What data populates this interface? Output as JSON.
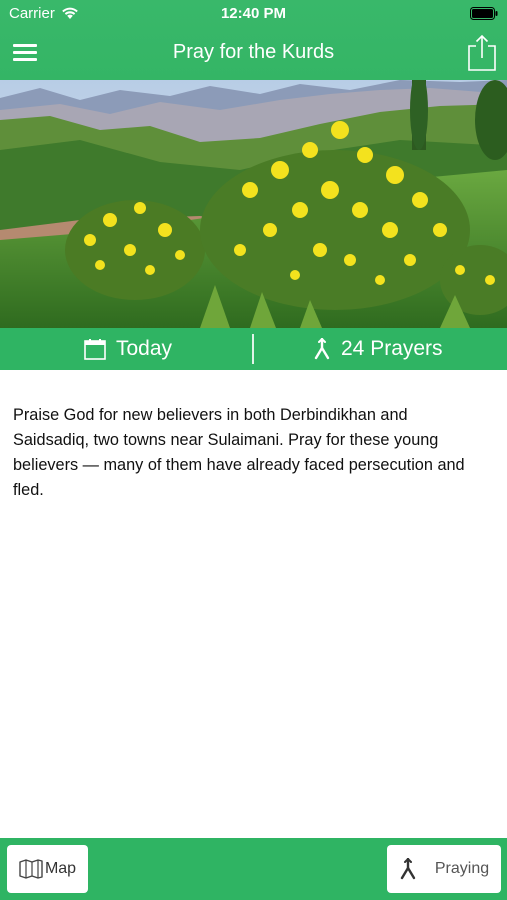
{
  "status_bar": {
    "carrier": "Carrier",
    "time": "12:40 PM",
    "wifi_icon": "wifi-icon",
    "battery_icon": "battery-icon"
  },
  "nav_bar": {
    "title": "Pray for the Kurds",
    "menu_icon": "hamburger-menu-icon",
    "share_icon": "share-icon"
  },
  "hero": {
    "description_icon": "mountain-landscape-with-yellow-flowers"
  },
  "info_bar": {
    "today_label": "Today",
    "today_icon": "calendar-icon",
    "prayers_label": "24 Prayers",
    "prayers_icon": "praying-hands-icon"
  },
  "content": {
    "prayer_text": "Praise God for new believers in both Derbindikhan and Saidsadiq, two towns near Sulaimani. Pray for these young believers — many of them have already faced persecution and fled."
  },
  "tab_bar": {
    "map_label": "Map",
    "map_icon": "map-icon",
    "praying_label": "Praying",
    "praying_icon": "praying-hands-icon"
  },
  "colors": {
    "brand_green": "#34b565",
    "info_bar_green": "#2fb463",
    "text": "#111111"
  }
}
